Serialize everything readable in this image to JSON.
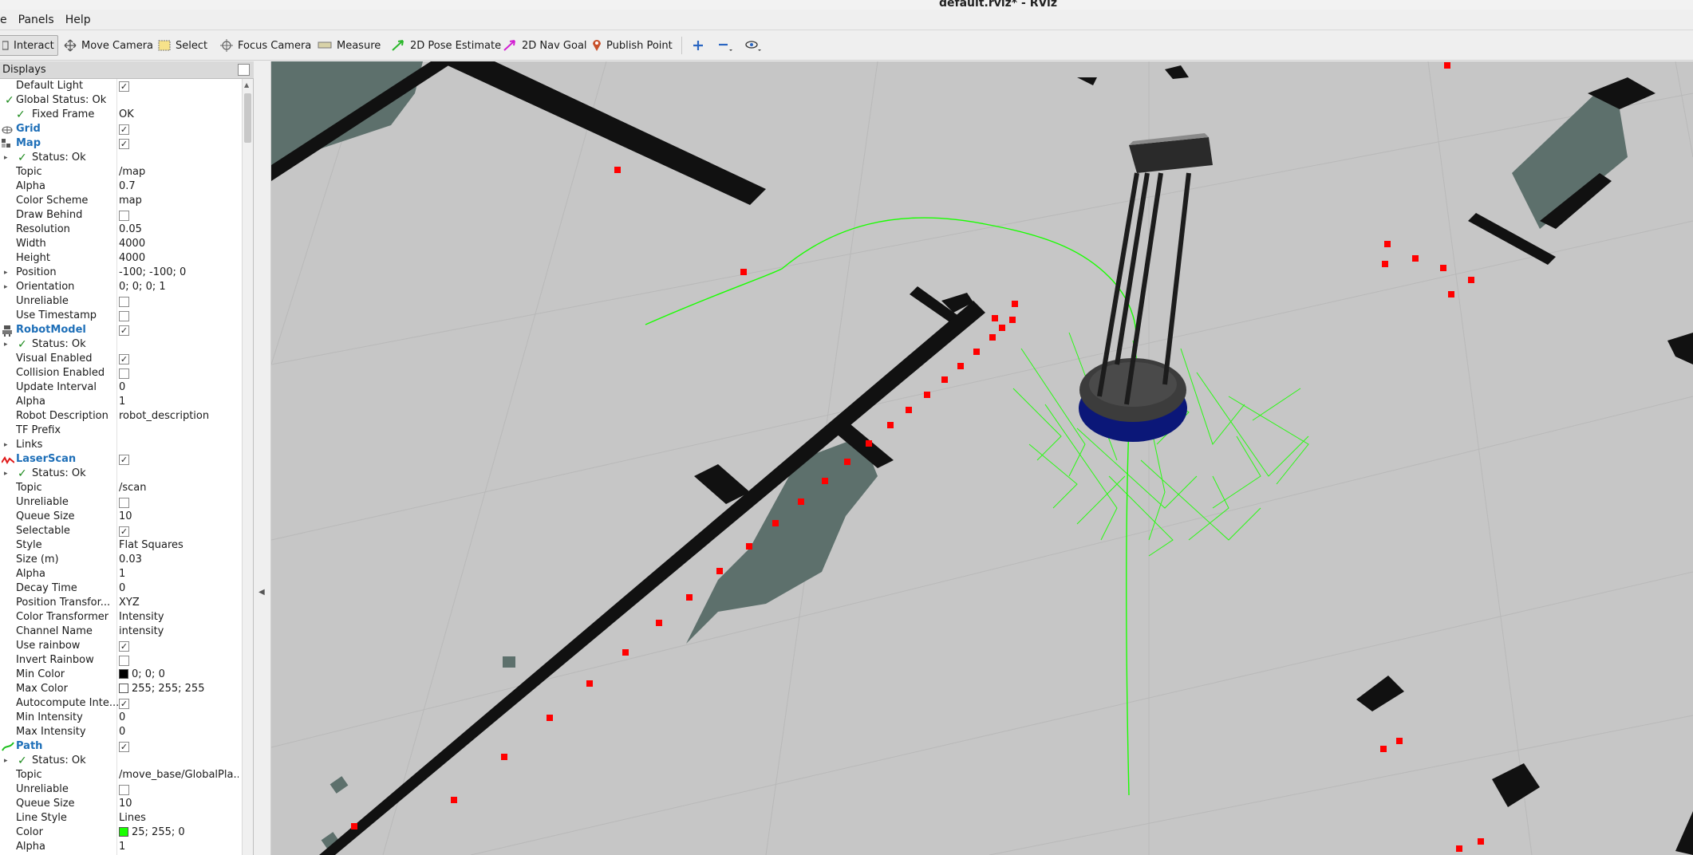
{
  "window": {
    "title": "default.rviz* - RViz"
  },
  "menu": [
    "e",
    "Panels",
    "Help"
  ],
  "toolbar": {
    "interact": "Interact",
    "move_camera": "Move Camera",
    "select": "Select",
    "focus_camera": "Focus Camera",
    "measure": "Measure",
    "pose_estimate": "2D Pose Estimate",
    "nav_goal": "2D Nav Goal",
    "publish_point": "Publish Point"
  },
  "displays_panel": {
    "title": "Displays",
    "rows": [
      {
        "name": "Default Light",
        "value": "",
        "check": true
      },
      {
        "name": "Global Status: Ok",
        "value": ""
      },
      {
        "name": "Fixed Frame",
        "value": "OK"
      },
      {
        "name": "Grid",
        "value": "",
        "check": true
      },
      {
        "name": "Map",
        "value": "",
        "check": true
      },
      {
        "name": "Status: Ok",
        "value": ""
      },
      {
        "name": "Topic",
        "value": "/map"
      },
      {
        "name": "Alpha",
        "value": "0.7"
      },
      {
        "name": "Color Scheme",
        "value": "map"
      },
      {
        "name": "Draw Behind",
        "value": "",
        "check": false
      },
      {
        "name": "Resolution",
        "value": "0.05"
      },
      {
        "name": "Width",
        "value": "4000"
      },
      {
        "name": "Height",
        "value": "4000"
      },
      {
        "name": "Position",
        "value": "-100; -100; 0"
      },
      {
        "name": "Orientation",
        "value": "0; 0; 0; 1"
      },
      {
        "name": "Unreliable",
        "value": "",
        "check": false
      },
      {
        "name": "Use Timestamp",
        "value": "",
        "check": false
      },
      {
        "name": "RobotModel",
        "value": "",
        "check": true
      },
      {
        "name": "Status: Ok",
        "value": ""
      },
      {
        "name": "Visual Enabled",
        "value": "",
        "check": true
      },
      {
        "name": "Collision Enabled",
        "value": "",
        "check": false
      },
      {
        "name": "Update Interval",
        "value": "0"
      },
      {
        "name": "Alpha",
        "value": "1"
      },
      {
        "name": "Robot Description",
        "value": "robot_description"
      },
      {
        "name": "TF Prefix",
        "value": ""
      },
      {
        "name": "Links",
        "value": ""
      },
      {
        "name": "LaserScan",
        "value": "",
        "check": true
      },
      {
        "name": "Status: Ok",
        "value": ""
      },
      {
        "name": "Topic",
        "value": "/scan"
      },
      {
        "name": "Unreliable",
        "value": "",
        "check": false
      },
      {
        "name": "Queue Size",
        "value": "10"
      },
      {
        "name": "Selectable",
        "value": "",
        "check": true
      },
      {
        "name": "Style",
        "value": "Flat Squares"
      },
      {
        "name": "Size (m)",
        "value": "0.03"
      },
      {
        "name": "Alpha",
        "value": "1"
      },
      {
        "name": "Decay Time",
        "value": "0"
      },
      {
        "name": "Position Transfor...",
        "value": "XYZ"
      },
      {
        "name": "Color Transformer",
        "value": "Intensity"
      },
      {
        "name": "Channel Name",
        "value": "intensity"
      },
      {
        "name": "Use rainbow",
        "value": "",
        "check": true
      },
      {
        "name": "Invert Rainbow",
        "value": "",
        "check": false
      },
      {
        "name": "Min Color",
        "value": "0; 0; 0",
        "swatch": "#000000"
      },
      {
        "name": "Max Color",
        "value": "255; 255; 255",
        "swatch": "#ffffff"
      },
      {
        "name": "Autocompute Inte...",
        "value": "",
        "check": true
      },
      {
        "name": "Min Intensity",
        "value": "0"
      },
      {
        "name": "Max Intensity",
        "value": "0"
      },
      {
        "name": "Path",
        "value": "",
        "check": true
      },
      {
        "name": "Status: Ok",
        "value": ""
      },
      {
        "name": "Topic",
        "value": "/move_base/GlobalPla..."
      },
      {
        "name": "Unreliable",
        "value": "",
        "check": false
      },
      {
        "name": "Queue Size",
        "value": "10"
      },
      {
        "name": "Line Style",
        "value": "Lines"
      },
      {
        "name": "Color",
        "value": "25; 255; 0",
        "swatch": "#19ff00"
      },
      {
        "name": "Alpha",
        "value": "1"
      }
    ]
  },
  "colors": {
    "plugin": "#1e6fb8",
    "status_ok": "#1c8a1c",
    "laser": "#ff0000",
    "path": "#19ff00",
    "map_occupied": "#111111",
    "map_unknown": "#5a6e6a",
    "map_free": "#c6c6c6"
  }
}
